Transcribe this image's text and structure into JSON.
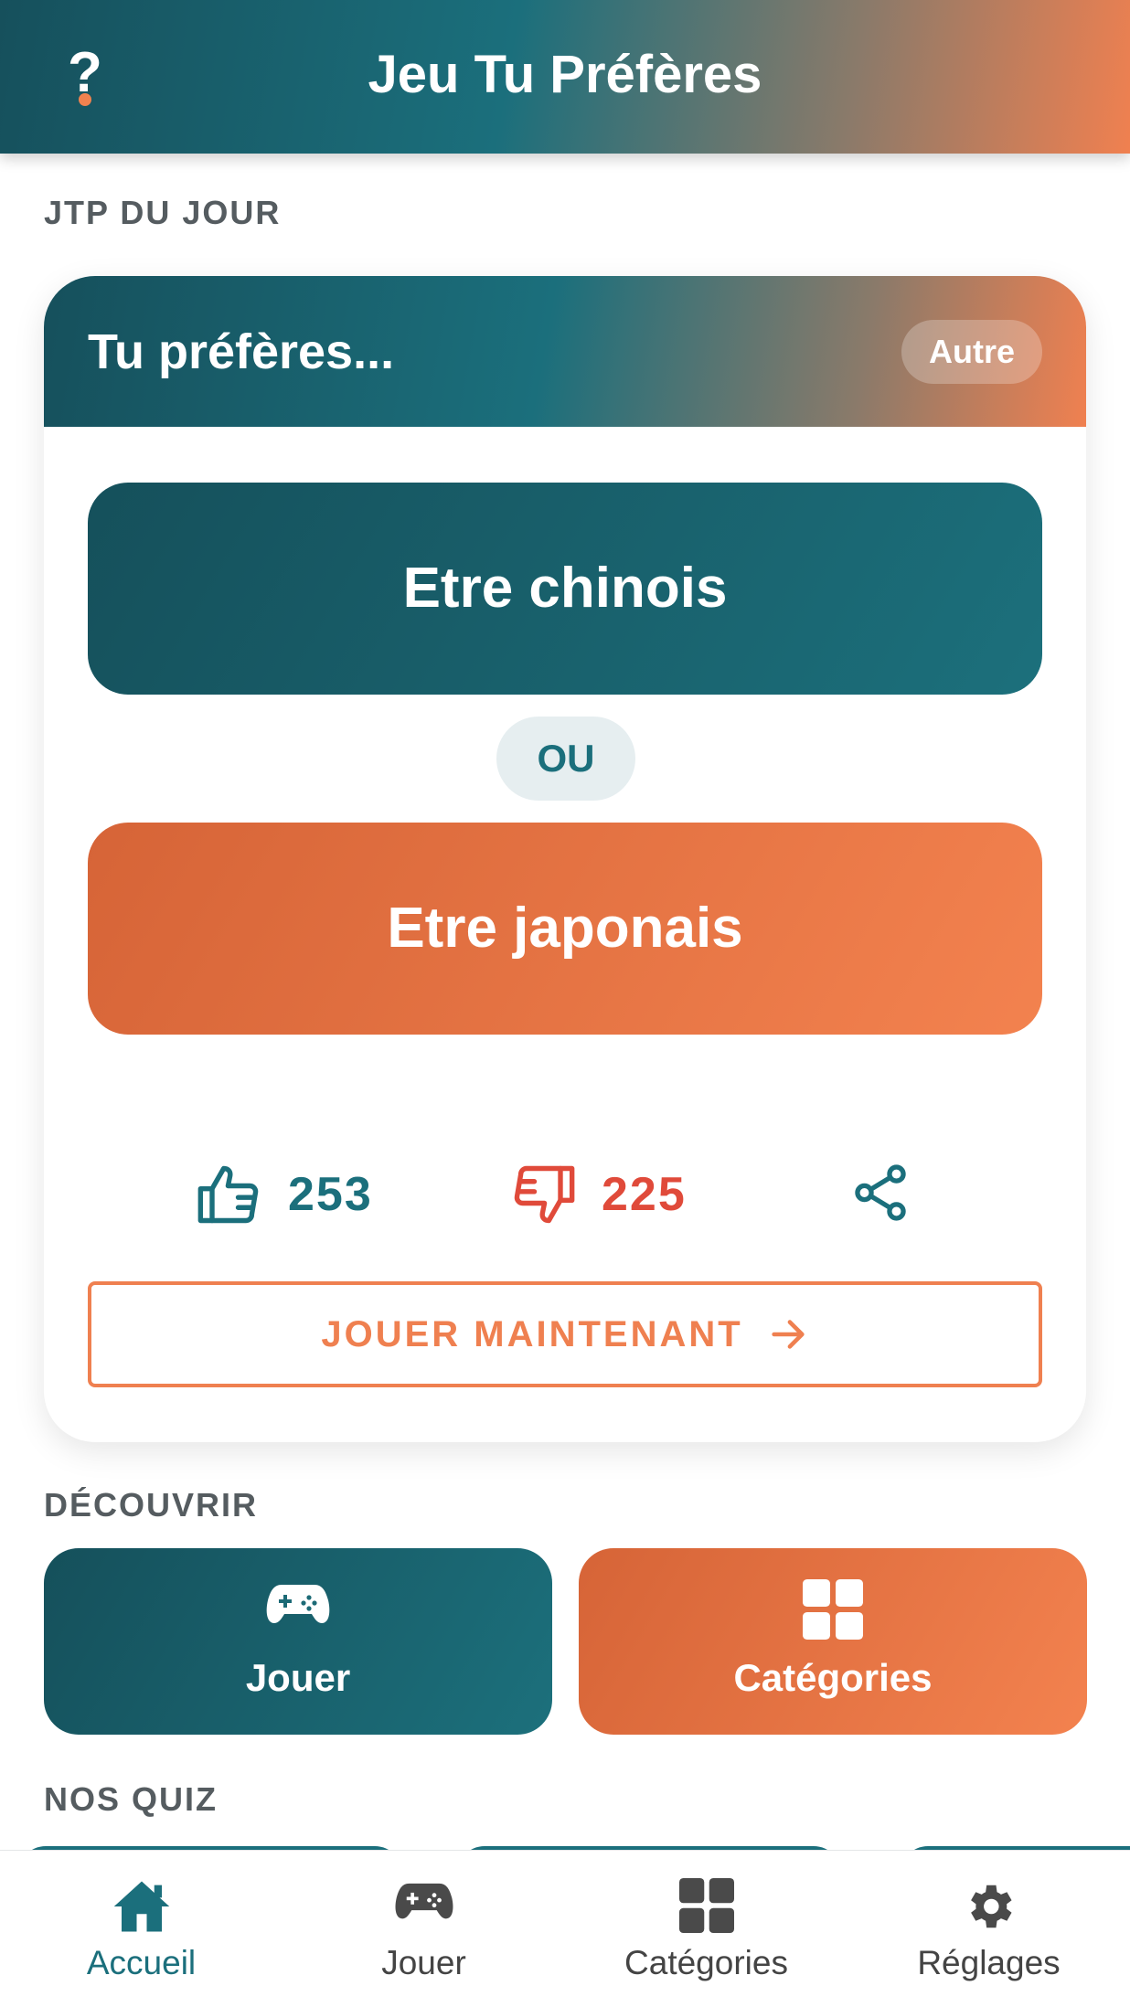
{
  "header": {
    "title": "Jeu Tu Préfères",
    "help_label": "?"
  },
  "daily": {
    "section_label": "JTP DU JOUR",
    "card_title": "Tu préfères...",
    "category_badge": "Autre",
    "option_a": "Etre chinois",
    "separator": "OU",
    "option_b": "Etre japonais",
    "likes": "253",
    "dislikes": "225",
    "play_now_label": "JOUER MAINTENANT"
  },
  "discover": {
    "section_label": "DÉCOUVRIR",
    "tiles": [
      {
        "label": "Jouer",
        "icon": "gamepad-icon"
      },
      {
        "label": "Catégories",
        "icon": "grid-icon"
      }
    ]
  },
  "quiz": {
    "section_label": "NOS QUIZ"
  },
  "nav": {
    "items": [
      {
        "label": "Accueil",
        "icon": "home-icon",
        "active": true
      },
      {
        "label": "Jouer",
        "icon": "gamepad-icon",
        "active": false
      },
      {
        "label": "Catégories",
        "icon": "grid-icon",
        "active": false
      },
      {
        "label": "Réglages",
        "icon": "gear-icon",
        "active": false
      }
    ]
  },
  "colors": {
    "teal": "#1b6f7c",
    "orange": "#f08050",
    "dislike_red": "#e04a3a"
  }
}
